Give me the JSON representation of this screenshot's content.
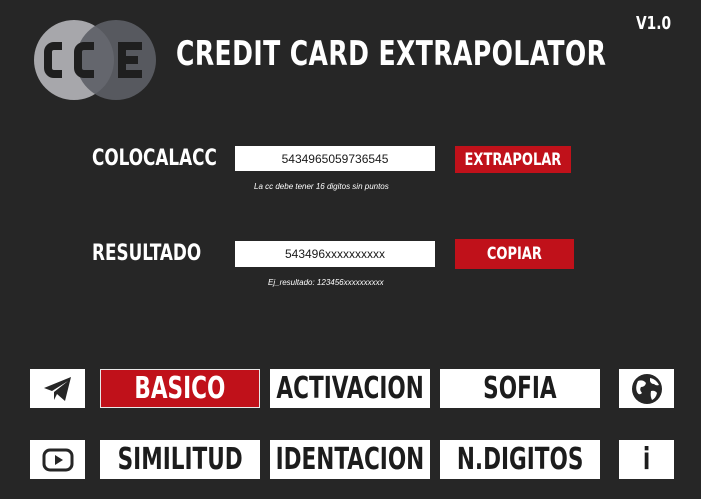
{
  "header": {
    "logo_text": "CCE",
    "title": "CREDIT CARD EXTRAPOLATOR",
    "version": "V1.0"
  },
  "input_section": {
    "label": "COLOCALACC",
    "value": "5434965059736545",
    "button_label": "EXTRAPOLAR",
    "hint": "La cc debe tener 16 digitos sin puntos"
  },
  "result_section": {
    "label": "RESULTADO",
    "value": "543496xxxxxxxxxx",
    "button_label": "COPIAR",
    "hint": "Ej_resultado: 123456xxxxxxxxxx"
  },
  "modes": {
    "row1": [
      "BASICO",
      "ACTIVACION",
      "SOFIA"
    ],
    "row2": [
      "SIMILITUD",
      "IDENTACION",
      "N.DIGITOS"
    ],
    "active": "BASICO"
  },
  "icons": {
    "telegram": "telegram-icon",
    "globe": "globe-icon",
    "youtube": "youtube-icon",
    "info": "i"
  },
  "colors": {
    "background": "#262626",
    "accent": "#c0111a",
    "panel": "#ffffff"
  }
}
